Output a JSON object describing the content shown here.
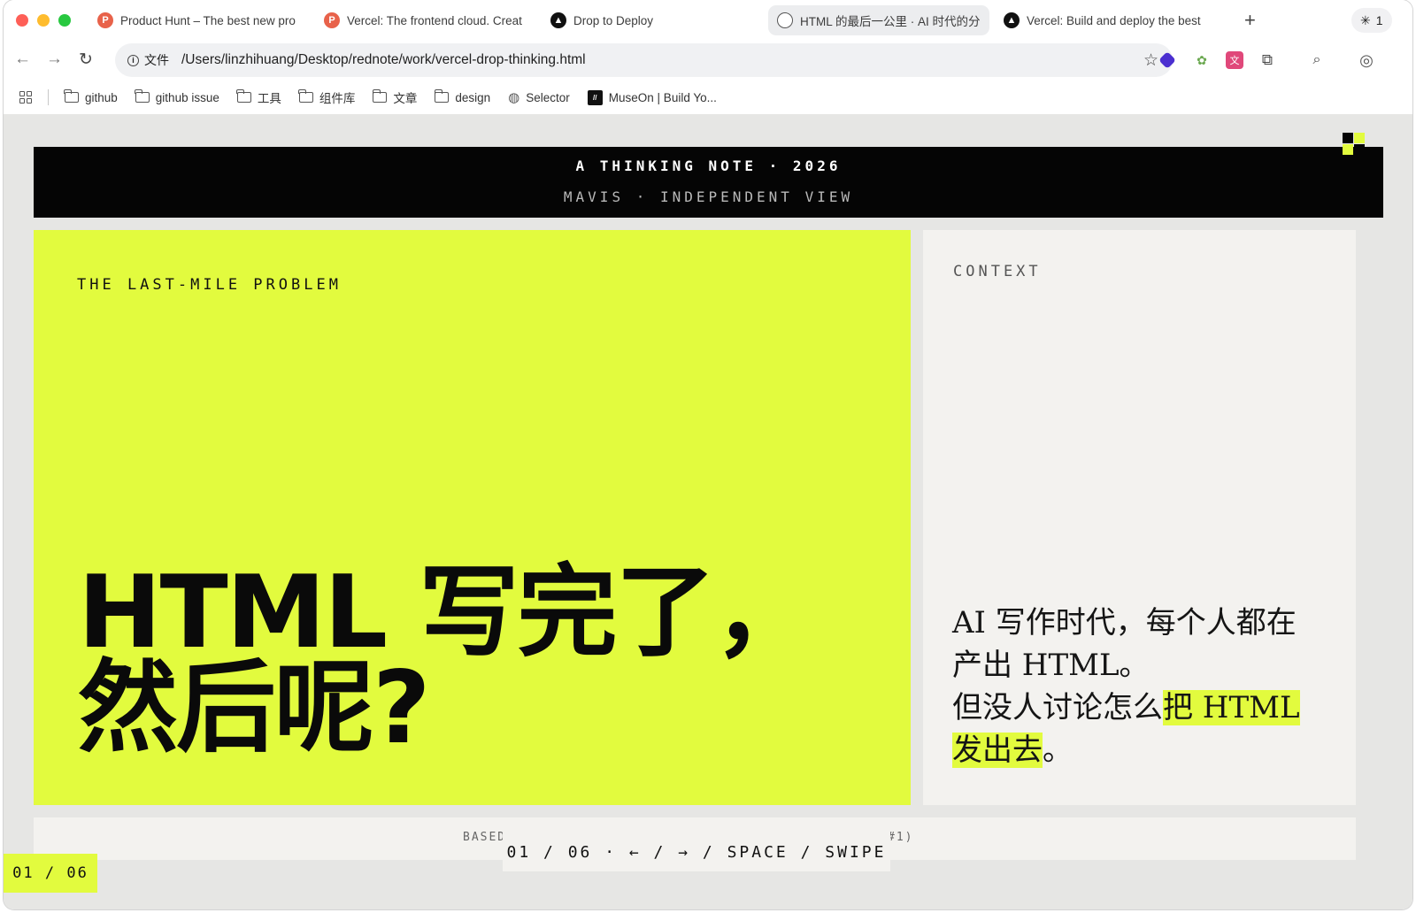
{
  "browser": {
    "tabs": [
      {
        "title": "Product Hunt – The best new pro",
        "favicon": "producthunt-icon"
      },
      {
        "title": "Vercel: The frontend cloud. Creat",
        "favicon": "producthunt-icon"
      },
      {
        "title": "Drop to Deploy",
        "favicon": "vercel-icon"
      },
      {
        "title": "HTML 的最后一公里 · AI 时代的分享",
        "favicon": "globe-icon",
        "active": true
      },
      {
        "title": "Vercel: Build and deploy the best",
        "favicon": "vercel-icon"
      }
    ],
    "new_tab": "+",
    "extension_count": "1",
    "address": {
      "security_label": "文件",
      "url": "/Users/linzhihuang/Desktop/rednote/work/vercel-drop-thinking.html"
    },
    "bookmarks": [
      {
        "label": "github",
        "icon": "folder-icon"
      },
      {
        "label": "github issue",
        "icon": "folder-icon"
      },
      {
        "label": "工具",
        "icon": "folder-icon"
      },
      {
        "label": "组件库",
        "icon": "folder-icon"
      },
      {
        "label": "文章",
        "icon": "folder-icon"
      },
      {
        "label": "design",
        "icon": "folder-icon"
      },
      {
        "label": "Selector",
        "icon": "globe-icon"
      },
      {
        "label": "MuseOn | Build Yo...",
        "icon": "museon-icon"
      }
    ]
  },
  "page": {
    "hero": {
      "line1": "A THINKING NOTE · 2026",
      "line2": "MAVIS · INDEPENDENT VIEW"
    },
    "left": {
      "kicker": "THE LAST-MILE PROBLEM",
      "headline_line1": "HTML 写完了，",
      "headline_line2": "然后呢?"
    },
    "right": {
      "label": "CONTEXT",
      "text_line1": "AI 写作时代，每个人都在",
      "text_line2": "产出 HTML。",
      "text_line3_pre": "但没人讨论怎么",
      "text_line3_hl": "把 HTML",
      "text_line4_hl": "发出去",
      "text_line4_post": "。"
    },
    "footer": {
      "source_left": "BASED",
      "source_right": "#1)",
      "nav_hint": "01 / 06 · ← / → / SPACE / SWIPE",
      "page_counter": "01 / 06"
    },
    "colors": {
      "accent": "#e2fb3e",
      "dark": "#050505",
      "panel": "#f3f2ef",
      "background": "#e6e6e4"
    }
  }
}
